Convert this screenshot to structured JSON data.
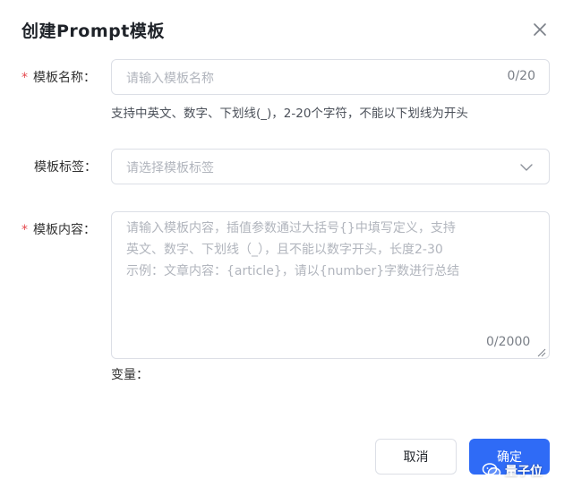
{
  "dialog": {
    "title": "创建Prompt模板",
    "close_icon": "close-icon"
  },
  "form": {
    "name": {
      "required_mark": "*",
      "label": "模板名称：",
      "placeholder": "请输入模板名称",
      "value": "",
      "counter": "0/20",
      "hint": "支持中英文、数字、下划线(_)，2-20个字符，不能以下划线为开头"
    },
    "tags": {
      "label": "模板标签：",
      "placeholder": "请选择模板标签",
      "dropdown_icon": "chevron-down-icon"
    },
    "content": {
      "required_mark": "*",
      "label": "模板内容：",
      "placeholder_lines": [
        "请输入模板内容，插值参数通过大括号{}中填写定义，支持",
        "英文、数字、下划线（_），且不能以数字开头，长度2-30",
        "示例：文章内容：{article}，请以{number}字数进行总结"
      ],
      "value": "",
      "counter": "0/2000"
    },
    "variables_label": "变量："
  },
  "footer": {
    "cancel_label": "取消",
    "confirm_label": "确定"
  },
  "watermark": {
    "text": "量子位",
    "icon": "wechat-icon"
  },
  "colors": {
    "primary": "#2f6bf6",
    "required": "#e5484d",
    "border": "#dcdfe6",
    "placeholder": "#b1b5bd"
  }
}
